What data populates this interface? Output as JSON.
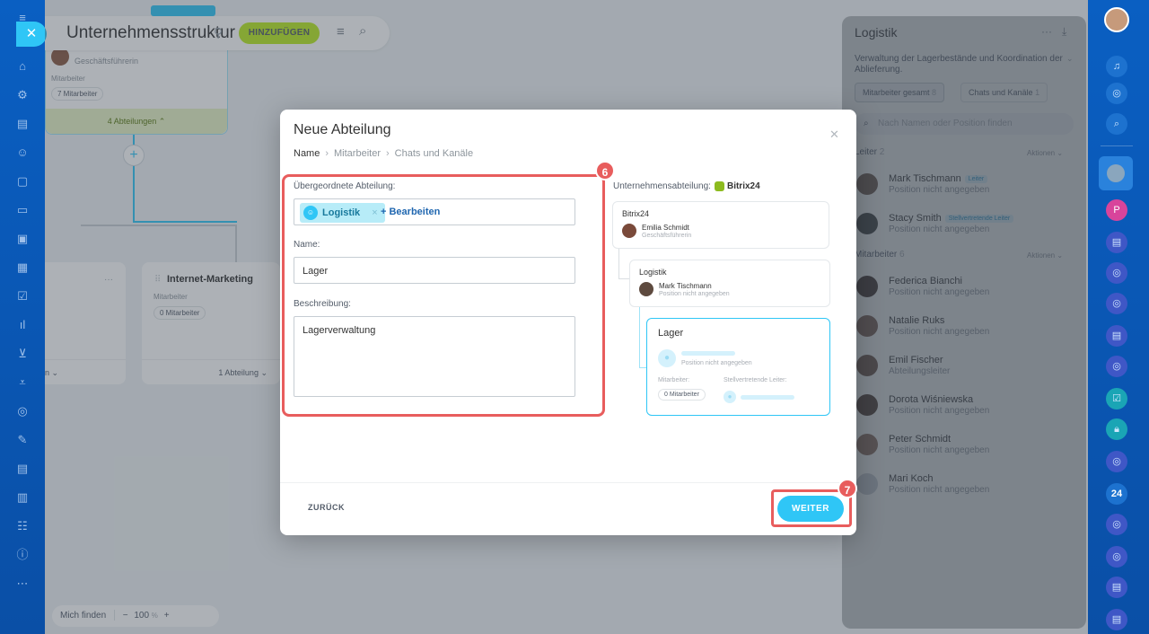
{
  "header": {
    "title": "Unternehmensstruktur",
    "add_label": "HINZUFÜGEN"
  },
  "canvas": {
    "top_card": {
      "role": "Geschäftsführerin",
      "members_label": "Mitarbeiter",
      "members_count": "7 Mitarbeiter",
      "departments_toggle": "4 Abteilungen ⌃"
    },
    "left_card": {
      "footer": "n ⌄"
    },
    "internet_marketing_card": {
      "title": "Internet-Marketing",
      "members_label": "Mitarbeiter",
      "members_count": "0 Mitarbeiter",
      "footer": "1 Abteilung ⌄"
    },
    "bottom_bar": {
      "find_me": "Mich finden",
      "zoom_minus": "−",
      "zoom_value": "100",
      "zoom_unit": "%",
      "zoom_plus": "+"
    }
  },
  "panel": {
    "title": "Logistik",
    "description": "Verwaltung der Lagerbestände und Koordination der Ablieferung.",
    "tabs": [
      {
        "label": "Mitarbeiter gesamt",
        "count": "8"
      },
      {
        "label": "Chats und Kanäle",
        "count": "1"
      }
    ],
    "search_placeholder": "Nach Namen oder Position finden",
    "leader_section": {
      "title": "Leiter",
      "count": "2",
      "actions": "Aktionen ⌄"
    },
    "leaders": [
      {
        "name": "Mark Tischmann",
        "badge": "Leiter",
        "position": "Position nicht angegeben"
      },
      {
        "name": "Stacy Smith",
        "badge": "Stellvertretende Leiter",
        "position": "Position nicht angegeben"
      }
    ],
    "employees_section": {
      "title": "Mitarbeiter",
      "count": "6",
      "actions": "Aktionen ⌄"
    },
    "employees": [
      {
        "name": "Federica Bianchi",
        "position": "Position nicht angegeben"
      },
      {
        "name": "Natalie Ruks",
        "position": "Position nicht angegeben"
      },
      {
        "name": "Emil Fischer",
        "position": "Abteilungsleiter"
      },
      {
        "name": "Dorota Wiśniewska",
        "position": "Position nicht angegeben"
      },
      {
        "name": "Peter Schmidt",
        "position": "Position nicht angegeben"
      },
      {
        "name": "Mari Koch",
        "position": "Position nicht angegeben"
      }
    ]
  },
  "modal": {
    "title": "Neue Abteilung",
    "breadcrumbs": [
      "Name",
      "Mitarbeiter",
      "Chats und Kanäle"
    ],
    "parent_label": "Übergeordnete Abteilung:",
    "parent_chip": "Logistik",
    "edit_link": "+ Bearbeiten",
    "name_label": "Name:",
    "name_value": "Lager",
    "description_label": "Beschreibung:",
    "description_value": "Lagerverwaltung",
    "step6": "6",
    "step7": "7",
    "back_label": "ZURÜCK",
    "next_label": "WEITER",
    "preview": {
      "company_label": "Unternehmensabteilung:",
      "company_name": "Bitrix24",
      "root": {
        "title": "Bitrix24",
        "person": "Emilia Schmidt",
        "role": "Geschäftsführerin"
      },
      "parent": {
        "title": "Logistik",
        "person": "Mark Tischmann",
        "role": "Position nicht angegeben"
      },
      "new_dept": {
        "title": "Lager",
        "position": "Position nicht angegeben",
        "members_label": "Mitarbeiter:",
        "members_count": "0 Mitarbeiter",
        "deputy_label": "Stellvertretende Leiter:"
      }
    }
  },
  "right_rail": {
    "badge_24": "24"
  },
  "colors": {
    "accent": "#2fc6f6",
    "add_button": "#bbed21",
    "highlight": "#e85d5d",
    "rail": "#0a5fc2"
  }
}
